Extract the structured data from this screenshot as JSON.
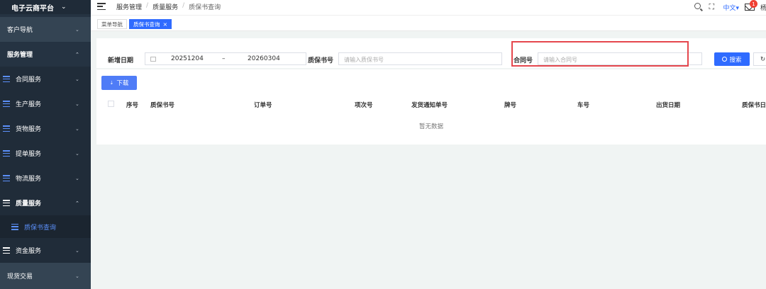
{
  "app": {
    "title": "电子云商平台"
  },
  "sidebar": {
    "items": [
      {
        "label": "客户导航"
      },
      {
        "label": "服务管理"
      },
      {
        "label": "合同服务"
      },
      {
        "label": "生产服务"
      },
      {
        "label": "货物服务"
      },
      {
        "label": "提单服务"
      },
      {
        "label": "物流服务"
      },
      {
        "label": "质量服务"
      },
      {
        "label": "质保书查询"
      },
      {
        "label": "资金服务"
      },
      {
        "label": "现货交易"
      }
    ]
  },
  "breadcrumb": {
    "items": [
      "服务管理",
      "质量服务",
      "质保书查询"
    ]
  },
  "header": {
    "language": "中文",
    "notification_count": "1",
    "user": "杨"
  },
  "tabs": [
    {
      "label": "菜单导航"
    },
    {
      "label": "质保书查询"
    }
  ],
  "filters": {
    "date_label": "新增日期",
    "date_start": "20251204",
    "date_sep": "–",
    "date_end": "20260304",
    "cert_label": "质保书号",
    "cert_placeholder": "请输入质保书号",
    "contract_label": "合同号",
    "contract_placeholder": "请输入合同号",
    "search_label": "搜索",
    "reset_label": "重"
  },
  "table": {
    "download_label": "下载",
    "columns": [
      "序号",
      "质保书号",
      "订单号",
      "项次号",
      "发货通知单号",
      "牌号",
      "车号",
      "出货日期",
      "质保书日"
    ],
    "empty_text": "暂无数据"
  },
  "colors": {
    "sidebar_bg": "#253342",
    "accent": "#2f6bff",
    "highlight": "#e5474d"
  }
}
